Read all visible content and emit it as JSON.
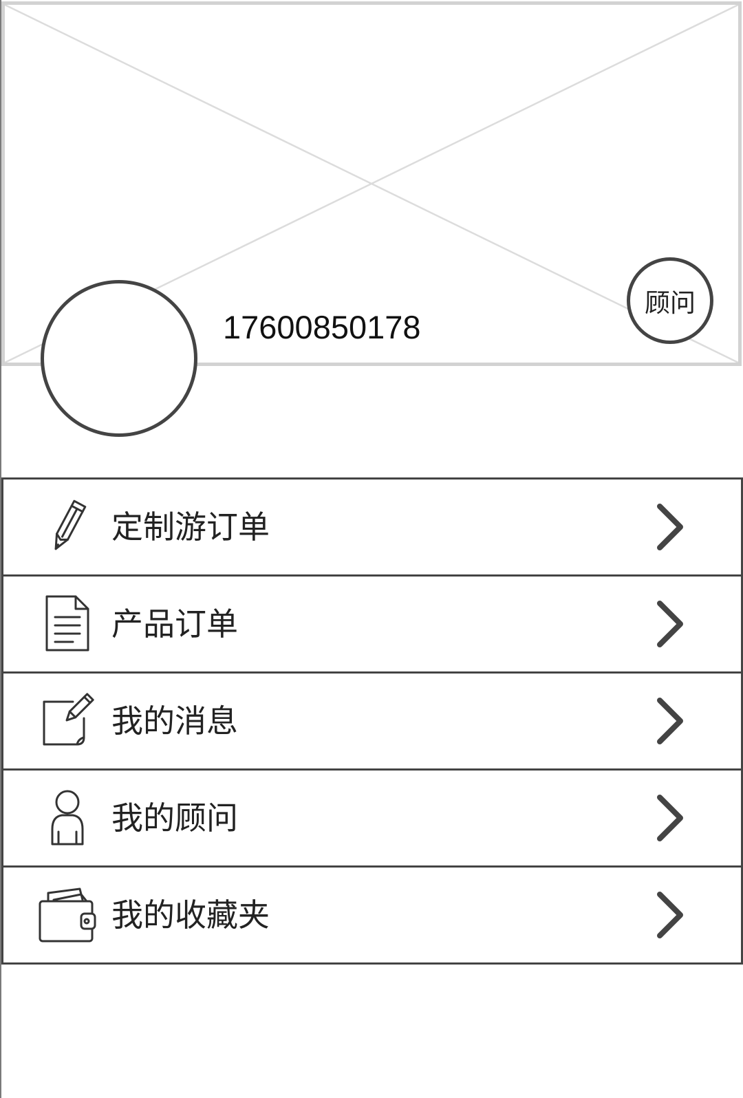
{
  "header": {
    "phone": "17600850178",
    "advisor_label": "顾问"
  },
  "menu": {
    "items": [
      {
        "label": "定制游订单",
        "icon": "pencil-icon"
      },
      {
        "label": "产品订单",
        "icon": "document-icon"
      },
      {
        "label": "我的消息",
        "icon": "note-edit-icon"
      },
      {
        "label": "我的顾问",
        "icon": "user-icon"
      },
      {
        "label": "我的收藏夹",
        "icon": "wallet-icon"
      }
    ]
  },
  "icons": {
    "banner": "image-placeholder-icon",
    "row_arrow": "chevron-right-icon"
  },
  "colors": {
    "stroke": "#444444",
    "placeholder_border": "#d2d2d2",
    "placeholder_cross": "#dcdcdc",
    "background": "#ffffff",
    "text": "#222222"
  }
}
